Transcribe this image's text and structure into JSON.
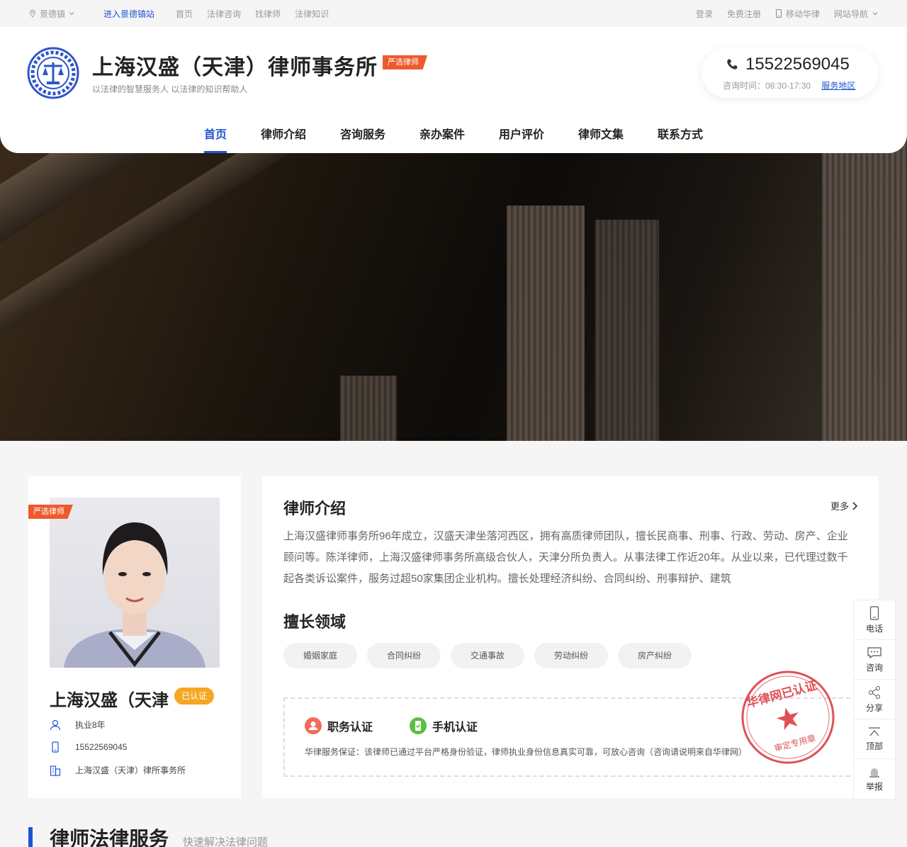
{
  "topbar": {
    "location": "景德镇",
    "enter_site": "进入景德镇站",
    "links": [
      "首页",
      "法律咨询",
      "找律师",
      "法律知识"
    ],
    "login": "登录",
    "register": "免费注册",
    "mobile": "移动华律",
    "site_nav": "网站导航"
  },
  "header": {
    "firm_name": "上海汉盛（天津）律师事务所",
    "badge": "严选律师",
    "slogan": "以法律的智慧服务人 以法律的知识帮助人",
    "phone": "15522569045",
    "hours": "咨询时间：08:30-17:30",
    "service_area": "服务地区"
  },
  "nav": [
    "首页",
    "律师介绍",
    "咨询服务",
    "亲办案件",
    "用户评价",
    "律师文集",
    "联系方式"
  ],
  "profile": {
    "badge": "严选律师",
    "name": "上海汉盛（天津",
    "verified": "已认证",
    "years": "执业8年",
    "phone": "15522569045",
    "firm": "上海汉盛（天津）律所事务所"
  },
  "intro": {
    "title": "律师介绍",
    "more": "更多",
    "text": "上海汉盛律师事务所96年成立，汉盛天津坐落河西区，拥有高质律师团队，擅长民商事、刑事、行政、劳动、房产、企业顾问等。陈洋律师，上海汉盛律师事务所高级合伙人，天津分所负责人。从事法律工作近20年。从业以来，已代理过数千起各类诉讼案件，服务过超50家集团企业机构。擅长处理经济纠纷、合同纠纷、刑事辩护、建筑"
  },
  "expertise": {
    "title": "擅长领域",
    "tags": [
      "婚姻家庭",
      "合同纠纷",
      "交通事故",
      "劳动纠纷",
      "房产纠纷"
    ]
  },
  "auth": {
    "job": "职务认证",
    "mobile": "手机认证",
    "note": "华律服务保证：该律师已通过平台严格身份验证，律师执业身份信息真实可靠，可放心咨询（咨询请说明来自华律网）",
    "stamp_top": "华律网已认证",
    "stamp_bottom": "审定专用章"
  },
  "float": [
    "电话",
    "咨询",
    "分享",
    "顶部",
    "举报"
  ],
  "section": {
    "title": "律师法律服务",
    "subtitle": "快速解决法律问题"
  },
  "colors": {
    "accent": "#2253d4",
    "badge": "#ef5a2c",
    "verified": "#f5a623",
    "stamp": "#d9333a"
  }
}
